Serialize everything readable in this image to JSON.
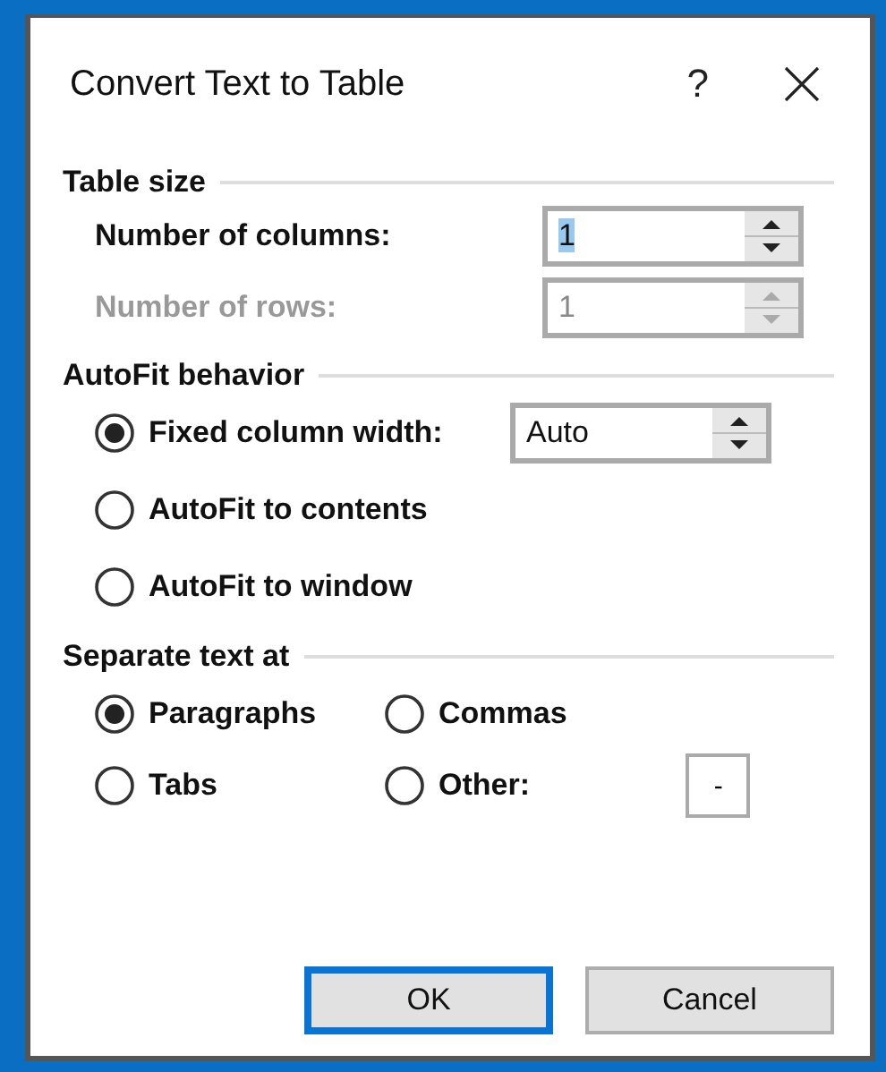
{
  "window": {
    "title": "Convert Text to Table",
    "help": "?"
  },
  "table_size": {
    "title": "Table size",
    "fields": [
      {
        "label": "Number of columns:",
        "value": "1",
        "disabled": false,
        "focused": true
      },
      {
        "label": "Number of rows:",
        "value": "1",
        "disabled": true,
        "focused": false
      }
    ]
  },
  "autofit": {
    "title": "AutoFit behavior",
    "options": [
      {
        "label": "Fixed column width:",
        "selected": true,
        "value": "Auto"
      },
      {
        "label": "AutoFit to contents",
        "selected": false
      },
      {
        "label": "AutoFit to window",
        "selected": false
      }
    ]
  },
  "separate": {
    "title": "Separate text at",
    "options": [
      {
        "label": "Paragraphs",
        "selected": true
      },
      {
        "label": "Commas",
        "selected": false
      },
      {
        "label": "Tabs",
        "selected": false
      },
      {
        "label": "Other:",
        "selected": false,
        "value": "-"
      }
    ]
  },
  "buttons": [
    {
      "label": "OK",
      "default": true
    },
    {
      "label": "Cancel",
      "default": false
    }
  ]
}
